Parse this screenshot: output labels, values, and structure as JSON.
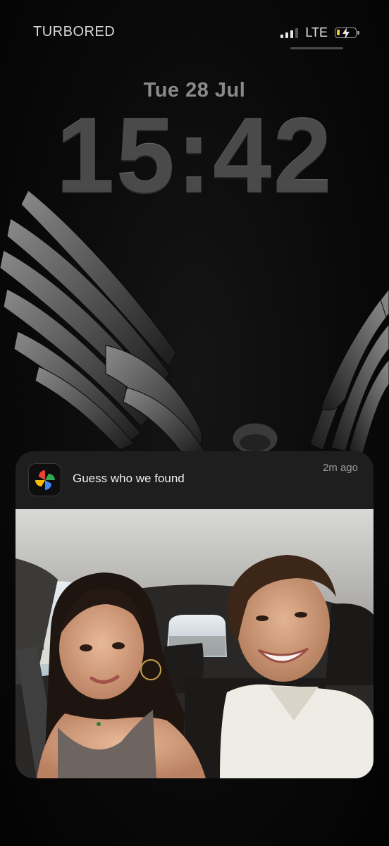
{
  "status_bar": {
    "carrier": "TURBORED",
    "network": "LTE",
    "signal_bars_active": 3,
    "signal_bars_total": 4,
    "battery_charging": true
  },
  "lockscreen": {
    "date": "Tue 28 Jul",
    "time": "15:42"
  },
  "notification": {
    "app_icon": "google-photos-pinwheel-icon",
    "title": "Guess who we found",
    "timestamp": "2m ago",
    "image_description": "car selfie photo attachment"
  },
  "colors": {
    "battery_accent": "#f4c430",
    "photos_red": "#ea4335",
    "photos_yellow": "#fbbc05",
    "photos_green": "#34a853",
    "photos_blue": "#4285f4"
  }
}
